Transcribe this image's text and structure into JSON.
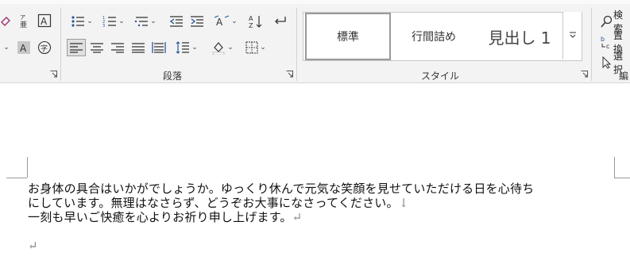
{
  "ribbon": {
    "groups": {
      "paragraph": {
        "label": "段落"
      },
      "styles": {
        "label": "スタイル"
      },
      "editing": {
        "label": "編"
      }
    },
    "styles": [
      {
        "label": "標準",
        "active": true
      },
      {
        "label": "行間詰め",
        "active": false
      },
      {
        "label": "見出し 1",
        "active": false
      }
    ],
    "editing": {
      "find": "検索",
      "replace": "置換",
      "select": "選択"
    }
  },
  "document": {
    "lines": [
      "お身体の具合はいかがでしょうか。ゆっくり休んで元気な笑顔を見せていただける日を心待ち",
      "にしています。無理はなさらず、どうぞお大事になさってください。",
      "一刻も早いご快癒を心よりお祈り申し上げます。"
    ],
    "line2_mark": "↓",
    "line3_mark": "↵",
    "empty_para_mark": "↵"
  },
  "colors": {
    "ribbon_bg": "#f3f3f3",
    "accent": "#2b579a"
  }
}
